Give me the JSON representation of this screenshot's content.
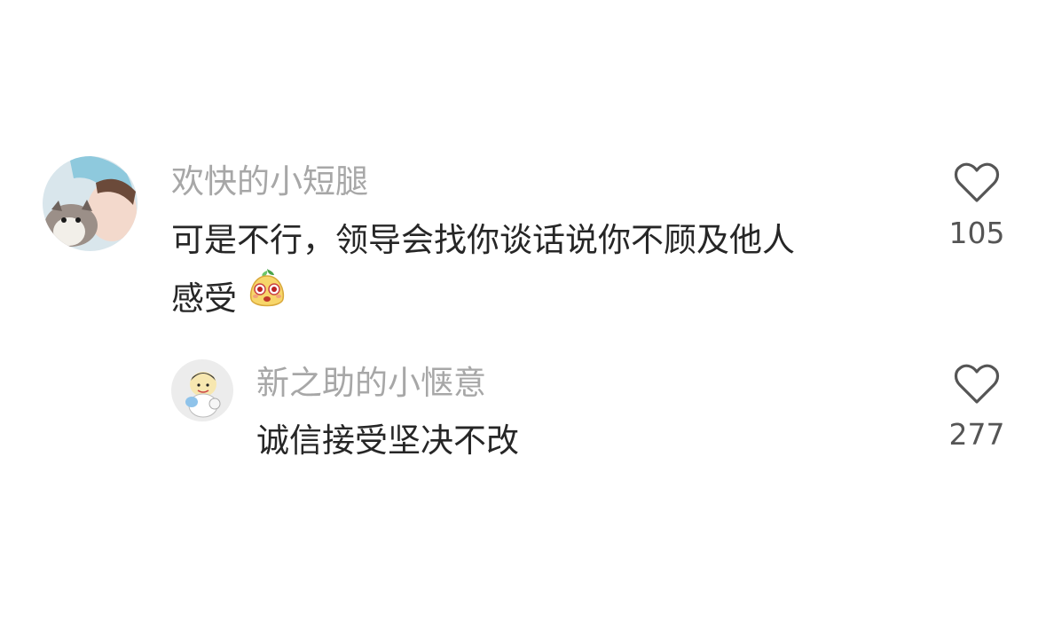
{
  "comments": [
    {
      "username": "欢快的小短腿",
      "text_line1": "可是不行，领导会找你谈话说你不顾及他人",
      "text_line2": "感受",
      "emoji_icon": "pear-face-emoji",
      "likes": "105"
    },
    {
      "username": "新之助的小惬意",
      "text": "诚信接受坚决不改",
      "likes": "277"
    }
  ],
  "colors": {
    "username": "#a7a7a7",
    "text": "#262626",
    "likes": "#555555",
    "heart": "#555555"
  }
}
